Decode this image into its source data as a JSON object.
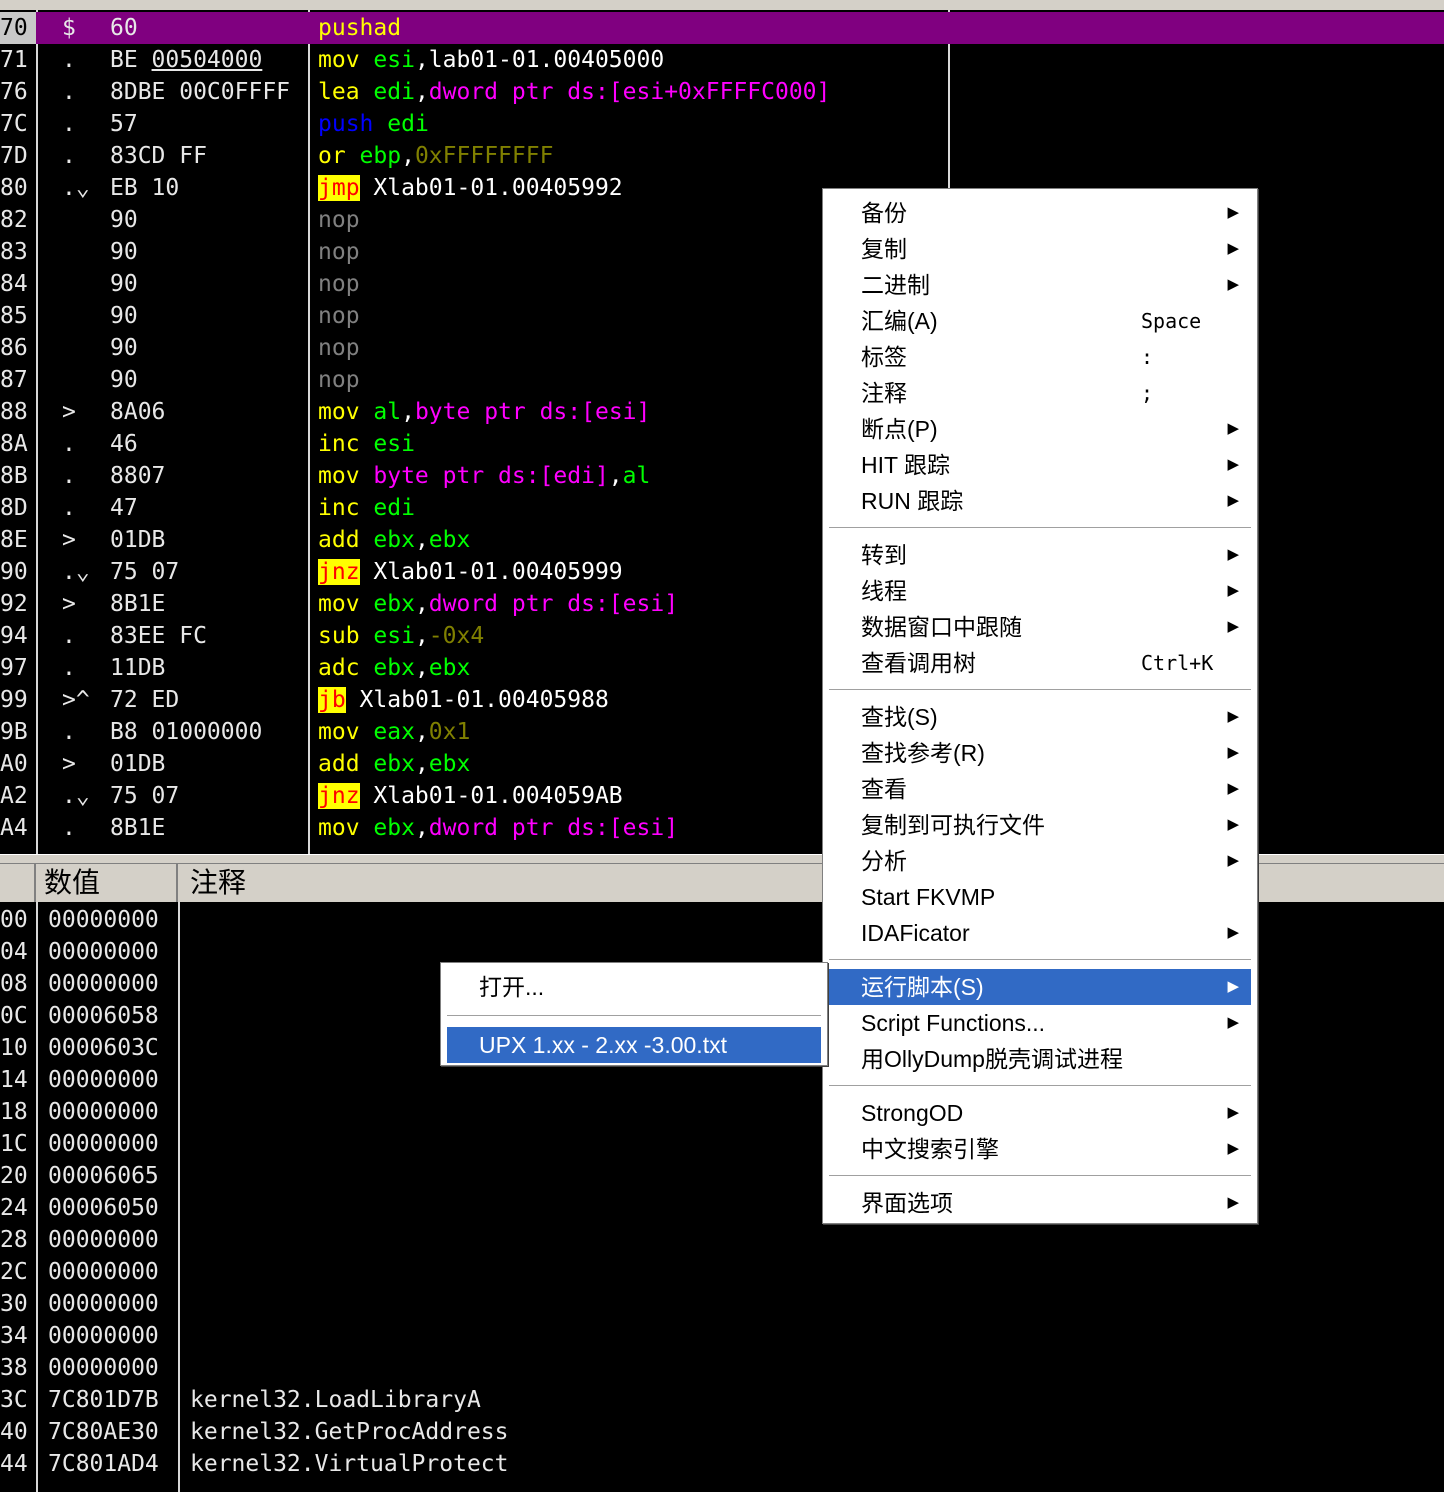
{
  "disasm": {
    "rows": [
      {
        "addr": "70",
        "mark": "$",
        "hex": "60",
        "asm": [
          {
            "t": "pushad",
            "c": "yel"
          }
        ]
      },
      {
        "addr": "71",
        "mark": ".",
        "hex": "BE 00504000",
        "asm": [
          {
            "t": "mov ",
            "c": "yel"
          },
          {
            "t": "esi",
            "c": "grn"
          },
          {
            "t": ",lab01-01.00405000",
            "c": "wht"
          }
        ]
      },
      {
        "addr": "76",
        "mark": ".",
        "hex": "8DBE 00C0FFFF",
        "asm": [
          {
            "t": "lea ",
            "c": "yel"
          },
          {
            "t": "edi",
            "c": "grn"
          },
          {
            "t": ",",
            "c": "wht"
          },
          {
            "t": "dword ptr ds:[esi+0xFFFFC000]",
            "c": "mag"
          }
        ]
      },
      {
        "addr": "7C",
        "mark": ".",
        "hex": "57",
        "asm": [
          {
            "t": "push ",
            "c": "blu"
          },
          {
            "t": "edi",
            "c": "grn"
          }
        ]
      },
      {
        "addr": "7D",
        "mark": ".",
        "hex": "83CD FF",
        "asm": [
          {
            "t": "or ",
            "c": "yel"
          },
          {
            "t": "ebp",
            "c": "grn"
          },
          {
            "t": ",",
            "c": "wht"
          },
          {
            "t": "0xFFFFFFFF",
            "c": "olv"
          }
        ]
      },
      {
        "addr": "80",
        "mark": ".⌄",
        "hex": "EB 10",
        "asm": [
          {
            "t": "jmp",
            "c": "jmp"
          },
          {
            "t": " Xlab01-01.00405992",
            "c": "wht"
          }
        ]
      },
      {
        "addr": "82",
        "mark": "",
        "hex": "90",
        "asm": [
          {
            "t": "nop",
            "c": "gry"
          }
        ]
      },
      {
        "addr": "83",
        "mark": "",
        "hex": "90",
        "asm": [
          {
            "t": "nop",
            "c": "gry"
          }
        ]
      },
      {
        "addr": "84",
        "mark": "",
        "hex": "90",
        "asm": [
          {
            "t": "nop",
            "c": "gry"
          }
        ]
      },
      {
        "addr": "85",
        "mark": "",
        "hex": "90",
        "asm": [
          {
            "t": "nop",
            "c": "gry"
          }
        ]
      },
      {
        "addr": "86",
        "mark": "",
        "hex": "90",
        "asm": [
          {
            "t": "nop",
            "c": "gry"
          }
        ]
      },
      {
        "addr": "87",
        "mark": "",
        "hex": "90",
        "asm": [
          {
            "t": "nop",
            "c": "gry"
          }
        ]
      },
      {
        "addr": "88",
        "mark": ">",
        "hex": "8A06",
        "asm": [
          {
            "t": "mov ",
            "c": "yel"
          },
          {
            "t": "al",
            "c": "grn"
          },
          {
            "t": ",",
            "c": "wht"
          },
          {
            "t": "byte ptr ds:[esi]",
            "c": "mag"
          }
        ]
      },
      {
        "addr": "8A",
        "mark": ".",
        "hex": "46",
        "asm": [
          {
            "t": "inc ",
            "c": "yel"
          },
          {
            "t": "esi",
            "c": "grn"
          }
        ]
      },
      {
        "addr": "8B",
        "mark": ".",
        "hex": "8807",
        "asm": [
          {
            "t": "mov ",
            "c": "yel"
          },
          {
            "t": "byte ptr ds:[edi]",
            "c": "mag"
          },
          {
            "t": ",",
            "c": "wht"
          },
          {
            "t": "al",
            "c": "grn"
          }
        ]
      },
      {
        "addr": "8D",
        "mark": ".",
        "hex": "47",
        "asm": [
          {
            "t": "inc ",
            "c": "yel"
          },
          {
            "t": "edi",
            "c": "grn"
          }
        ]
      },
      {
        "addr": "8E",
        "mark": ">",
        "hex": "01DB",
        "asm": [
          {
            "t": "add ",
            "c": "yel"
          },
          {
            "t": "ebx",
            "c": "grn"
          },
          {
            "t": ",",
            "c": "wht"
          },
          {
            "t": "ebx",
            "c": "grn"
          }
        ]
      },
      {
        "addr": "90",
        "mark": ".⌄",
        "hex": "75 07",
        "asm": [
          {
            "t": "jnz",
            "c": "jmp"
          },
          {
            "t": " Xlab01-01.00405999",
            "c": "wht"
          }
        ]
      },
      {
        "addr": "92",
        "mark": ">",
        "hex": "8B1E",
        "asm": [
          {
            "t": "mov ",
            "c": "yel"
          },
          {
            "t": "ebx",
            "c": "grn"
          },
          {
            "t": ",",
            "c": "wht"
          },
          {
            "t": "dword ptr ds:[esi]",
            "c": "mag"
          }
        ]
      },
      {
        "addr": "94",
        "mark": ".",
        "hex": "83EE FC",
        "asm": [
          {
            "t": "sub ",
            "c": "yel"
          },
          {
            "t": "esi",
            "c": "grn"
          },
          {
            "t": ",",
            "c": "wht"
          },
          {
            "t": "-0x4",
            "c": "olv"
          }
        ]
      },
      {
        "addr": "97",
        "mark": ".",
        "hex": "11DB",
        "asm": [
          {
            "t": "adc ",
            "c": "yel"
          },
          {
            "t": "ebx",
            "c": "grn"
          },
          {
            "t": ",",
            "c": "wht"
          },
          {
            "t": "ebx",
            "c": "grn"
          }
        ]
      },
      {
        "addr": "99",
        "mark": ">^",
        "hex": "72 ED",
        "asm": [
          {
            "t": "jb",
            "c": "jmp"
          },
          {
            "t": " Xlab01-01.00405988",
            "c": "wht"
          }
        ]
      },
      {
        "addr": "9B",
        "mark": ".",
        "hex": "B8 01000000",
        "asm": [
          {
            "t": "mov ",
            "c": "yel"
          },
          {
            "t": "eax",
            "c": "grn"
          },
          {
            "t": ",",
            "c": "wht"
          },
          {
            "t": "0x1",
            "c": "olv"
          }
        ]
      },
      {
        "addr": "A0",
        "mark": ">",
        "hex": "01DB",
        "asm": [
          {
            "t": "add ",
            "c": "yel"
          },
          {
            "t": "ebx",
            "c": "grn"
          },
          {
            "t": ",",
            "c": "wht"
          },
          {
            "t": "ebx",
            "c": "grn"
          }
        ]
      },
      {
        "addr": "A2",
        "mark": ".⌄",
        "hex": "75 07",
        "asm": [
          {
            "t": "jnz",
            "c": "jmp"
          },
          {
            "t": " Xlab01-01.004059AB",
            "c": "wht"
          }
        ]
      },
      {
        "addr": "A4",
        "mark": ".",
        "hex": "8B1E",
        "asm": [
          {
            "t": "mov ",
            "c": "yel"
          },
          {
            "t": "ebx",
            "c": "grn"
          },
          {
            "t": ",",
            "c": "wht"
          },
          {
            "t": "dword ptr ds:[esi]",
            "c": "mag"
          }
        ]
      }
    ]
  },
  "stack": {
    "headers": {
      "value": "数值",
      "comment": "注释"
    },
    "rows": [
      {
        "a": "00",
        "v": "00000000",
        "c": ""
      },
      {
        "a": "04",
        "v": "00000000",
        "c": ""
      },
      {
        "a": "08",
        "v": "00000000",
        "c": ""
      },
      {
        "a": "0C",
        "v": "00006058",
        "c": ""
      },
      {
        "a": "10",
        "v": "0000603C",
        "c": ""
      },
      {
        "a": "14",
        "v": "00000000",
        "c": ""
      },
      {
        "a": "18",
        "v": "00000000",
        "c": ""
      },
      {
        "a": "1C",
        "v": "00000000",
        "c": ""
      },
      {
        "a": "20",
        "v": "00006065",
        "c": ""
      },
      {
        "a": "24",
        "v": "00006050",
        "c": ""
      },
      {
        "a": "28",
        "v": "00000000",
        "c": ""
      },
      {
        "a": "2C",
        "v": "00000000",
        "c": ""
      },
      {
        "a": "30",
        "v": "00000000",
        "c": ""
      },
      {
        "a": "34",
        "v": "00000000",
        "c": ""
      },
      {
        "a": "38",
        "v": "00000000",
        "c": ""
      },
      {
        "a": "3C",
        "v": "7C801D7B",
        "c": "kernel32.LoadLibraryA"
      },
      {
        "a": "40",
        "v": "7C80AE30",
        "c": "kernel32.GetProcAddress"
      },
      {
        "a": "44",
        "v": "7C801AD4",
        "c": "kernel32.VirtualProtect"
      }
    ]
  },
  "context_menu": {
    "items": [
      {
        "label": "备份",
        "submenu": true
      },
      {
        "label": "复制",
        "submenu": true
      },
      {
        "label": "二进制",
        "submenu": true
      },
      {
        "label": "汇编(A)",
        "shortcut": "Space"
      },
      {
        "label": "标签",
        "shortcut": ":"
      },
      {
        "label": "注释",
        "shortcut": ";"
      },
      {
        "label": "断点(P)",
        "submenu": true
      },
      {
        "label": "HIT 跟踪",
        "submenu": true
      },
      {
        "label": "RUN 跟踪",
        "submenu": true
      },
      {
        "sep": true
      },
      {
        "label": "转到",
        "submenu": true
      },
      {
        "label": "线程",
        "submenu": true
      },
      {
        "label": "数据窗口中跟随",
        "submenu": true
      },
      {
        "label": "查看调用树",
        "shortcut": "Ctrl+K"
      },
      {
        "sep": true
      },
      {
        "label": "查找(S)",
        "submenu": true
      },
      {
        "label": "查找参考(R)",
        "submenu": true
      },
      {
        "label": "查看",
        "submenu": true
      },
      {
        "label": "复制到可执行文件",
        "submenu": true
      },
      {
        "label": "分析",
        "submenu": true
      },
      {
        "label": "Start FKVMP"
      },
      {
        "label": "IDAFicator",
        "submenu": true
      },
      {
        "sep": true
      },
      {
        "label": "运行脚本(S)",
        "submenu": true,
        "highlighted": true
      },
      {
        "label": "Script Functions...",
        "submenu": true
      },
      {
        "label": "用OllyDump脱壳调试进程"
      },
      {
        "sep": true
      },
      {
        "label": "StrongOD",
        "submenu": true
      },
      {
        "label": "中文搜索引擎",
        "submenu": true
      },
      {
        "sep": true
      },
      {
        "label": "界面选项",
        "submenu": true
      }
    ]
  },
  "script_submenu": {
    "items": [
      {
        "label": "打开..."
      },
      {
        "sep": true
      },
      {
        "label": "UPX 1.xx - 2.xx -3.00.txt",
        "highlighted": true
      }
    ]
  },
  "colors": {
    "selection": "#800080",
    "menu_highlight": "#316ac5",
    "keyword": "#ffff00",
    "register": "#00ff00",
    "memory": "#ff00ff",
    "constant": "#808000",
    "jump_bg": "#ffff00",
    "jump_fg": "#ff0000"
  }
}
